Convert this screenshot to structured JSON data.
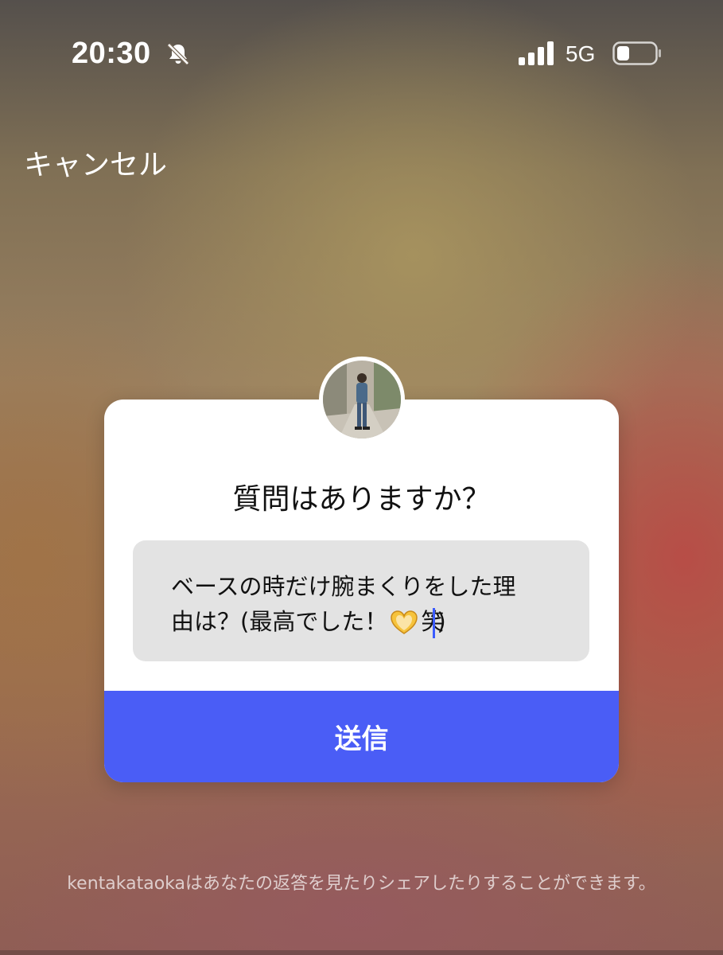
{
  "status_bar": {
    "time": "20:30",
    "network": "5G",
    "icons": [
      "bell-slash-icon",
      "signal-bars-icon",
      "battery-icon"
    ]
  },
  "header": {
    "cancel_label": "キャンセル"
  },
  "question_card": {
    "title": "質問はありますか？",
    "answer_line1": "ベースの時だけ腕まくりをした理",
    "answer_line2_start": "由は？(最高でした！",
    "answer_line2_end": "笑)",
    "emoji": "heart-hands-icon",
    "send_label": "送信",
    "accent_color": "#4a5df6"
  },
  "footer": {
    "note": "kentakataokaはあなたの返答を見たりシェアしたりすることができます。"
  }
}
